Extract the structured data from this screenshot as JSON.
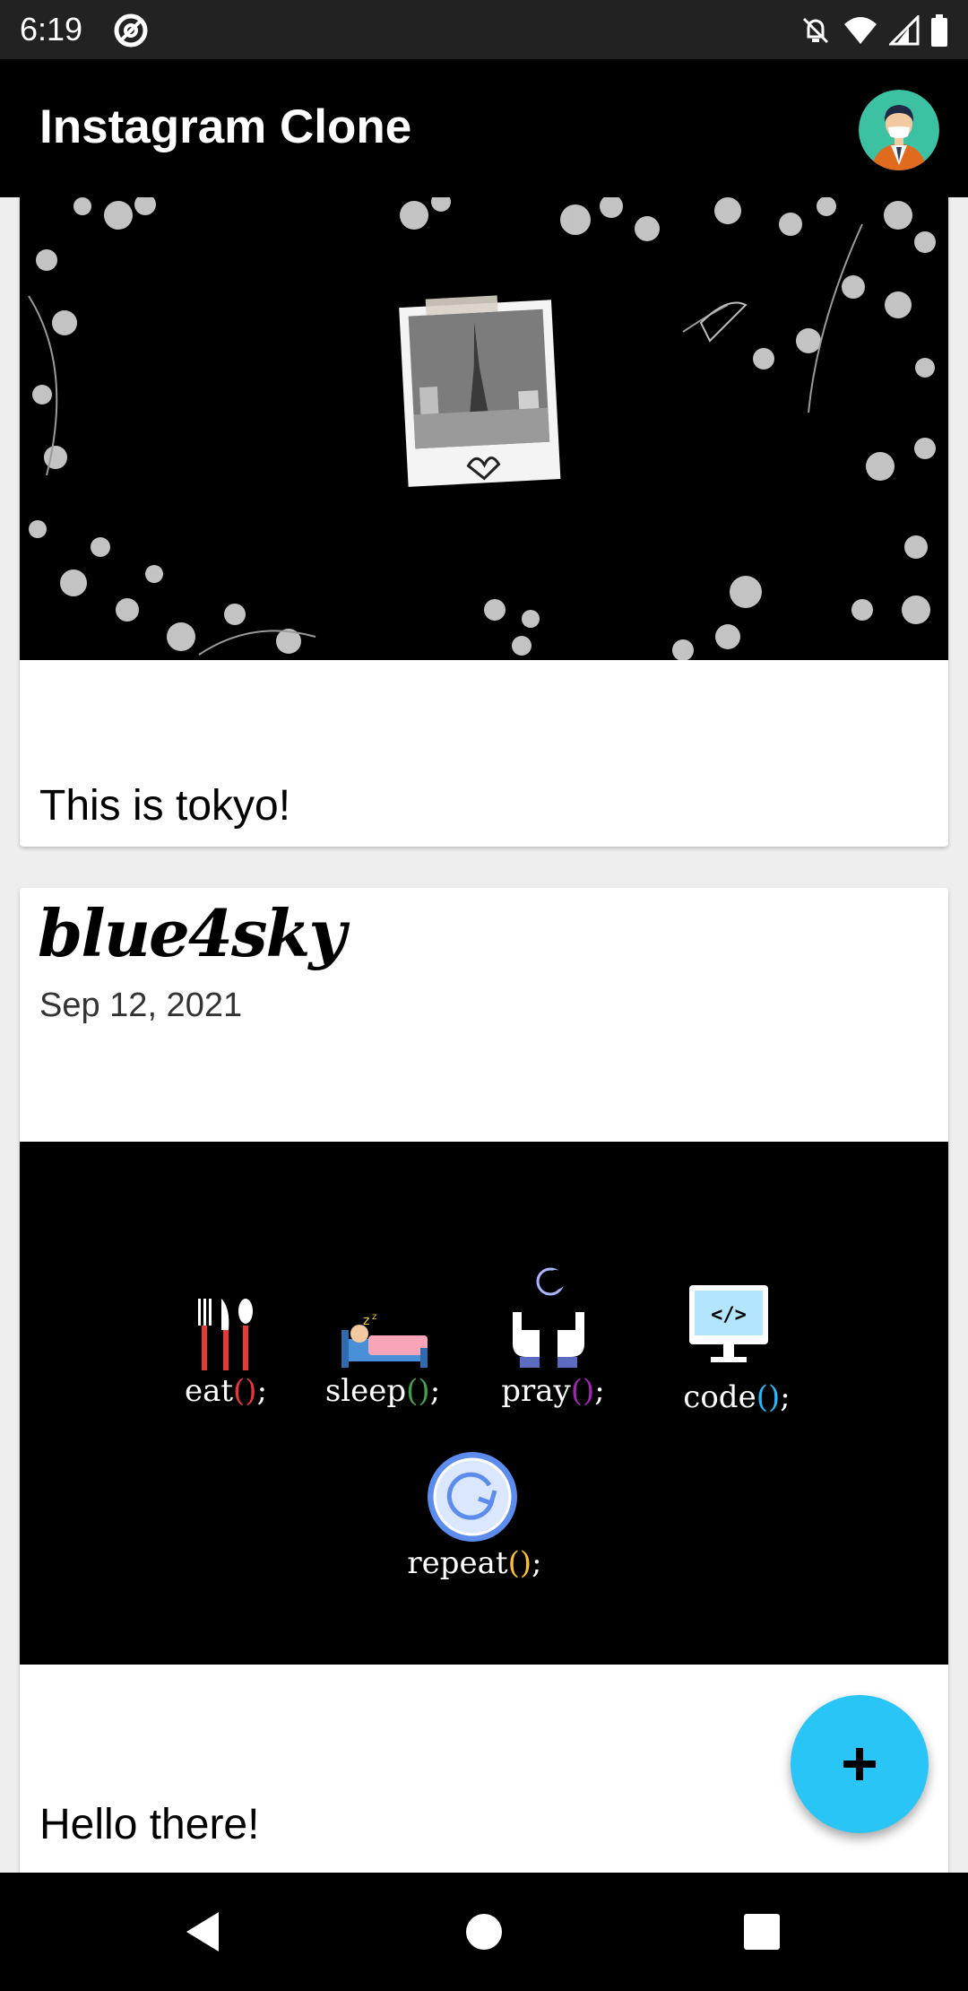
{
  "status_bar": {
    "time": "6:19",
    "icons": [
      "at-sign-icon",
      "notifications-off-icon",
      "wifi-icon",
      "signal-icon",
      "battery-icon"
    ]
  },
  "app_bar": {
    "title": "Instagram Clone",
    "avatar_icon": "user-avatar-icon"
  },
  "posts": [
    {
      "image": "tokyo-polaroid-flowers-image",
      "caption": "This is tokyo!"
    },
    {
      "username": "blue4sky",
      "date": "Sep 12, 2021",
      "image": "eat-sleep-pray-code-repeat-image",
      "image_labels": {
        "eat": "eat",
        "sleep": "sleep",
        "pray": "pray",
        "code": "code",
        "repeat": "repeat",
        "suffix": "();"
      },
      "caption": "Hello there!"
    }
  ],
  "fab": {
    "icon": "plus-icon"
  },
  "nav_bar": {
    "icons": [
      "back-icon",
      "home-icon",
      "recents-icon"
    ]
  },
  "colors": {
    "fab": "#29c5f6",
    "app_bar": "#000000",
    "status_bar": "#222222"
  }
}
